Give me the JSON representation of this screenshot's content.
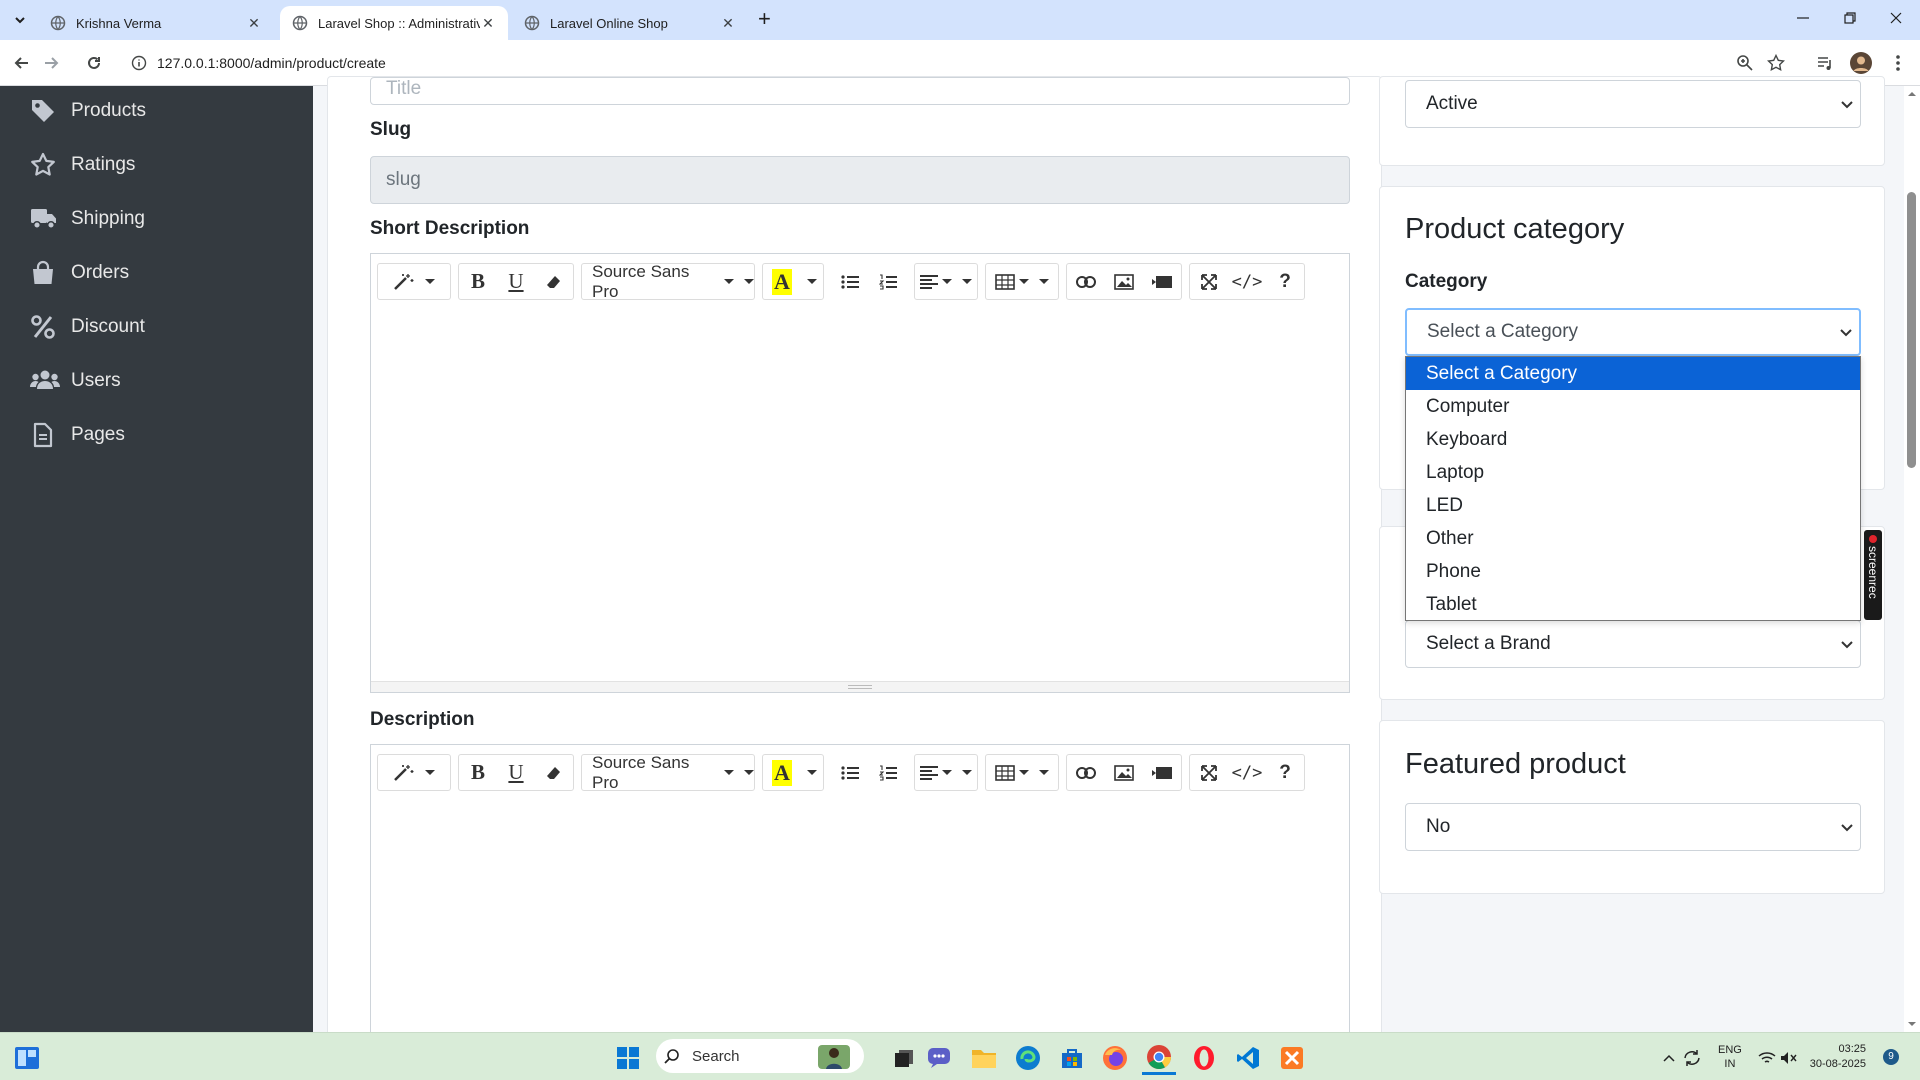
{
  "browser": {
    "tabs": [
      {
        "title": "Krishna Verma"
      },
      {
        "title": "Laravel Shop :: Administrative P"
      },
      {
        "title": "Laravel Online Shop"
      }
    ],
    "new_tab": "+",
    "url": "127.0.0.1:8000/admin/product/create"
  },
  "sidebar": {
    "items": [
      {
        "label": "Products",
        "icon": "tag-icon"
      },
      {
        "label": "Ratings",
        "icon": "star-icon"
      },
      {
        "label": "Shipping",
        "icon": "truck-icon"
      },
      {
        "label": "Orders",
        "icon": "shopping-bag-icon"
      },
      {
        "label": "Discount",
        "icon": "percent-icon"
      },
      {
        "label": "Users",
        "icon": "users-icon"
      },
      {
        "label": "Pages",
        "icon": "file-icon"
      }
    ]
  },
  "form": {
    "title_placeholder": "Title",
    "slug_label": "Slug",
    "slug_placeholder": "slug",
    "short_description_label": "Short Description",
    "description_label": "Description",
    "editor_font": "Source Sans Pro",
    "editor_bold": "B",
    "editor_underline": "U",
    "editor_code": "</>",
    "editor_help": "?",
    "editor_color": "A"
  },
  "status_card": {
    "selected": "Active"
  },
  "category_card": {
    "heading": "Product category",
    "label": "Category",
    "selected": "Select a Category",
    "options": [
      "Select a Category",
      "Computer",
      "Keyboard",
      "Laptop",
      "LED",
      "Other",
      "Phone",
      "Tablet"
    ]
  },
  "brand_card": {
    "selected": "Select a Brand"
  },
  "featured_card": {
    "heading": "Featured product",
    "selected": "No"
  },
  "overlay": {
    "screenrec": "screenrec"
  },
  "taskbar": {
    "search_placeholder": "Search",
    "lang_top": "ENG",
    "lang_bottom": "IN",
    "time": "03:25",
    "date": "30-08-2025",
    "notifications": "9"
  },
  "colors": {
    "sidebar": "#343a40",
    "highlight": "#0b63d6",
    "tabbar": "#d3e3fd",
    "taskbar": "#d9ecd8"
  }
}
